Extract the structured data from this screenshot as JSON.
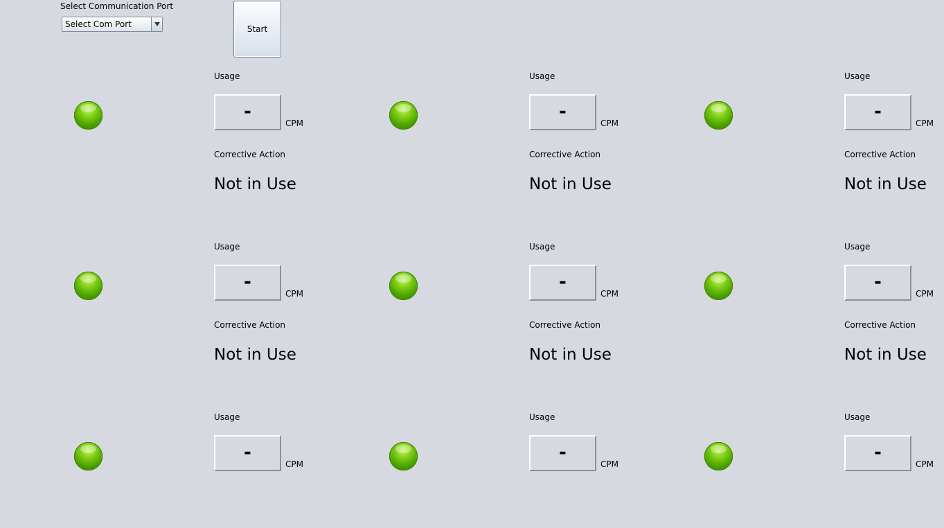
{
  "port": {
    "label": "Select Communication Port",
    "selected": "Select Com Port"
  },
  "start_label": "Start",
  "labels": {
    "usage": "Usage",
    "cpm": "CPM",
    "corrective_action": "Corrective Action"
  },
  "stations": [
    {
      "usage_value": "-",
      "action": "Not in Use",
      "lights": {
        "top": "green",
        "left": "red",
        "center": "green",
        "right": "red",
        "bottom": "green"
      }
    },
    {
      "usage_value": "-",
      "action": "Not in Use",
      "lights": {
        "top": "green",
        "left": "red",
        "center": "green",
        "right": "red",
        "bottom": "green"
      }
    },
    {
      "usage_value": "-",
      "action": "Not in Use",
      "lights": {
        "top": "green",
        "left": "red",
        "center": "green",
        "right": "red",
        "bottom": "green"
      }
    },
    {
      "usage_value": "-",
      "action": "Not in Use",
      "lights": {
        "top": "green",
        "left": "red",
        "center": "green",
        "right": "red",
        "bottom": "green"
      }
    },
    {
      "usage_value": "-",
      "action": "Not in Use",
      "lights": {
        "top": "green",
        "left": "red",
        "center": "green",
        "right": "red",
        "bottom": "green"
      }
    },
    {
      "usage_value": "-",
      "action": "Not in Use",
      "lights": {
        "top": "green",
        "left": "red",
        "center": "green",
        "right": "red",
        "bottom": "green"
      }
    },
    {
      "usage_value": "-",
      "action": "Not in Use",
      "lights": {
        "top": "green",
        "left": "red",
        "center": "green",
        "right": "red",
        "bottom": "green"
      }
    },
    {
      "usage_value": "-",
      "action": "Not in Use",
      "lights": {
        "top": "green",
        "left": "red",
        "center": "green",
        "right": "red",
        "bottom": "green"
      }
    },
    {
      "usage_value": "-",
      "action": "Not in Use",
      "lights": {
        "top": "green",
        "left": "red",
        "center": "green",
        "right": "red",
        "bottom": "green"
      }
    }
  ],
  "colors": {
    "background": "#d6d9e0",
    "light_green": "#4ea600",
    "light_red": "#b9300c"
  }
}
